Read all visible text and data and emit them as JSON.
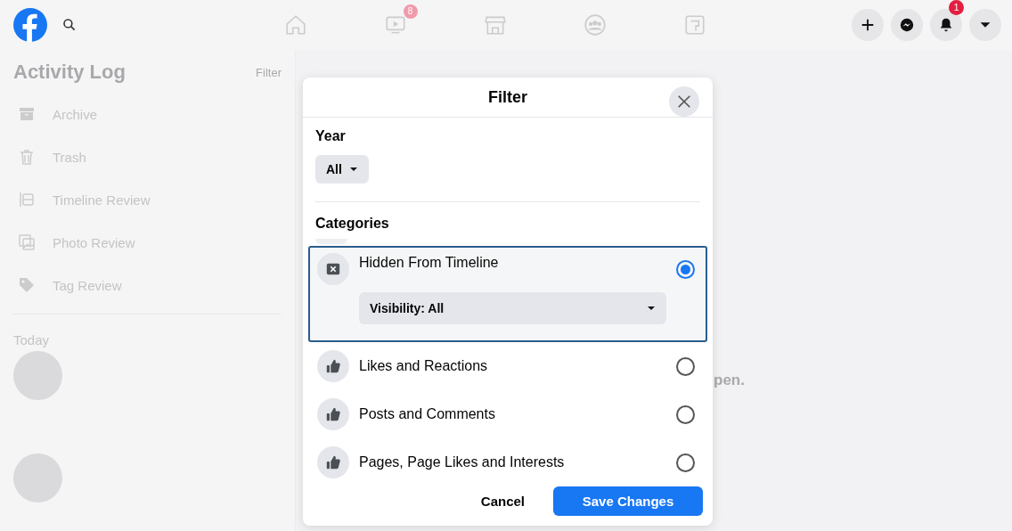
{
  "topbar": {
    "video_badge": "8",
    "notification_badge": "1"
  },
  "sidebar": {
    "title": "Activity Log",
    "filter_link": "Filter",
    "items": [
      {
        "label": "Archive",
        "kind": "archive"
      },
      {
        "label": "Trash",
        "kind": "trash"
      },
      {
        "label": "Timeline Review",
        "kind": "timeline"
      },
      {
        "label": "Photo Review",
        "kind": "photo"
      },
      {
        "label": "Tag Review",
        "kind": "tag"
      }
    ],
    "section": "Today"
  },
  "main": {
    "partial_text": "pen."
  },
  "modal": {
    "title": "Filter",
    "year_label": "Year",
    "year_value": "All",
    "categories_label": "Categories",
    "categories": [
      {
        "label": "Hidden From Timeline",
        "kind": "hidden",
        "selected": true,
        "visibility": "Visibility: All"
      },
      {
        "label": "Likes and Reactions",
        "kind": "like",
        "selected": false
      },
      {
        "label": "Posts and Comments",
        "kind": "like",
        "selected": false
      },
      {
        "label": "Pages, Page Likes and Interests",
        "kind": "like",
        "selected": false
      }
    ],
    "buttons": {
      "cancel": "Cancel",
      "save": "Save Changes"
    }
  }
}
